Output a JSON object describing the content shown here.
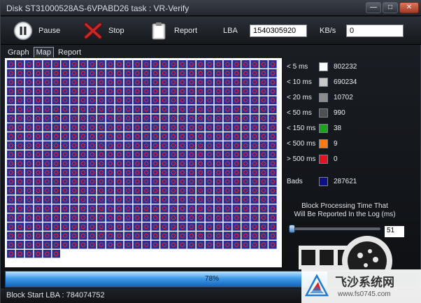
{
  "window": {
    "title": "Disk ST31000528AS-6VPABD26   task : VR-Verify",
    "controls": [
      "—",
      "□",
      "✕"
    ]
  },
  "toolbar": {
    "pause_label": "Pause",
    "stop_label": "Stop",
    "report_label": "Report",
    "lba_label": "LBA",
    "lba_value": "1540305920",
    "kbs_label": "KB/s",
    "kbs_value": "0"
  },
  "tabs": [
    {
      "label": "Graph",
      "active": false
    },
    {
      "label": "Map",
      "active": true
    },
    {
      "label": "Report",
      "active": false
    }
  ],
  "map": {
    "block_color": "#2a2f8f",
    "block_mark_color": "#d3253c",
    "background": "#ffffff"
  },
  "legend": [
    {
      "label": "< 5 ms",
      "count": "802232",
      "color": "#ffffff"
    },
    {
      "label": "< 10 ms",
      "count": "690234",
      "color": "#c8c8c8"
    },
    {
      "label": "< 20 ms",
      "count": "10702",
      "color": "#8c8c8c"
    },
    {
      "label": "< 50 ms",
      "count": "990",
      "color": "#4f4f4f"
    },
    {
      "label": "< 150 ms",
      "count": "38",
      "color": "#1aa51a"
    },
    {
      "label": "< 500 ms",
      "count": "9",
      "color": "#ff7a12"
    },
    {
      "label": "> 500 ms",
      "count": "0",
      "color": "#e0141c"
    },
    {
      "label": "Bads",
      "count": "287621",
      "color": "#0c1088"
    }
  ],
  "note": {
    "line1": "Block Processing Time That",
    "line2": "Will Be Reported In the Log (ms)"
  },
  "slider": {
    "value": "51",
    "level": 0
  },
  "progress": {
    "percent": 78,
    "text": "78%"
  },
  "status": {
    "text": "Block Start LBA : 784074752"
  },
  "watermark": {
    "title": "飞沙系统网",
    "url": "www.fs0745.com"
  }
}
